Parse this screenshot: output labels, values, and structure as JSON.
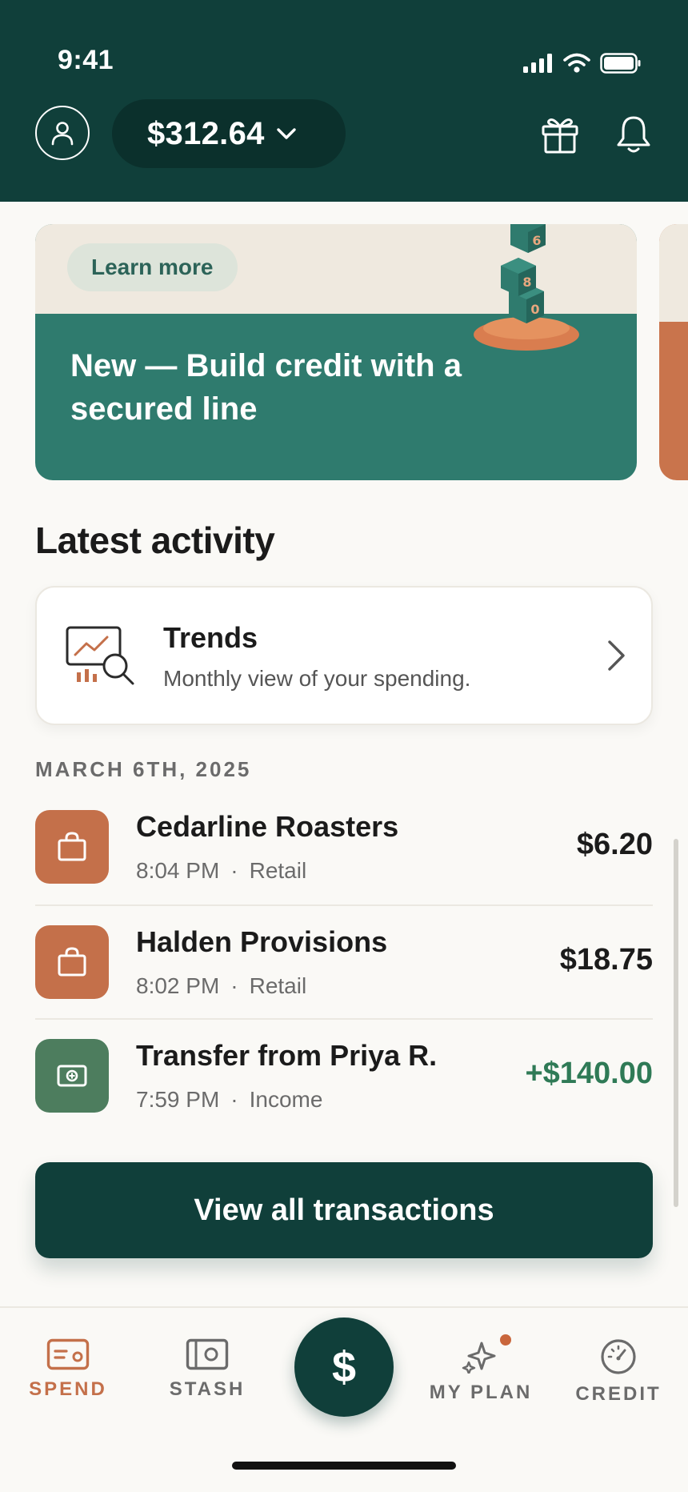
{
  "status": {
    "time": "9:41"
  },
  "header": {
    "balance": "$312.64"
  },
  "promo": {
    "pill": "Learn more",
    "title": "New — Build credit with a secured line",
    "art_digits": [
      "6",
      "8",
      "0"
    ]
  },
  "activity": {
    "title": "Latest activity",
    "trends": {
      "title": "Trends",
      "subtitle": "Monthly view of your spending."
    },
    "date": "MARCH 6TH, 2025",
    "transactions": [
      {
        "name": "Cedarline Roasters",
        "time": "8:04 PM",
        "category": "Retail",
        "amount": "$6.20"
      },
      {
        "name": "Halden Provisions",
        "time": "8:02 PM",
        "category": "Retail",
        "amount": "$18.75"
      },
      {
        "name": "Transfer from Priya R.",
        "time": "7:59 PM",
        "category": "Income",
        "amount": "+$140.00"
      }
    ],
    "separator": "·",
    "view_all": "View all transactions"
  },
  "tabs": {
    "spend": "SPEND",
    "stash": "STASH",
    "center": "$",
    "plan": "MY PLAN",
    "credit": "CREDIT"
  },
  "colors": {
    "brand_dark": "#103f3a",
    "accent_orange": "#c4704a",
    "teal": "#2f7b6e",
    "income_green": "#2f7a56"
  }
}
